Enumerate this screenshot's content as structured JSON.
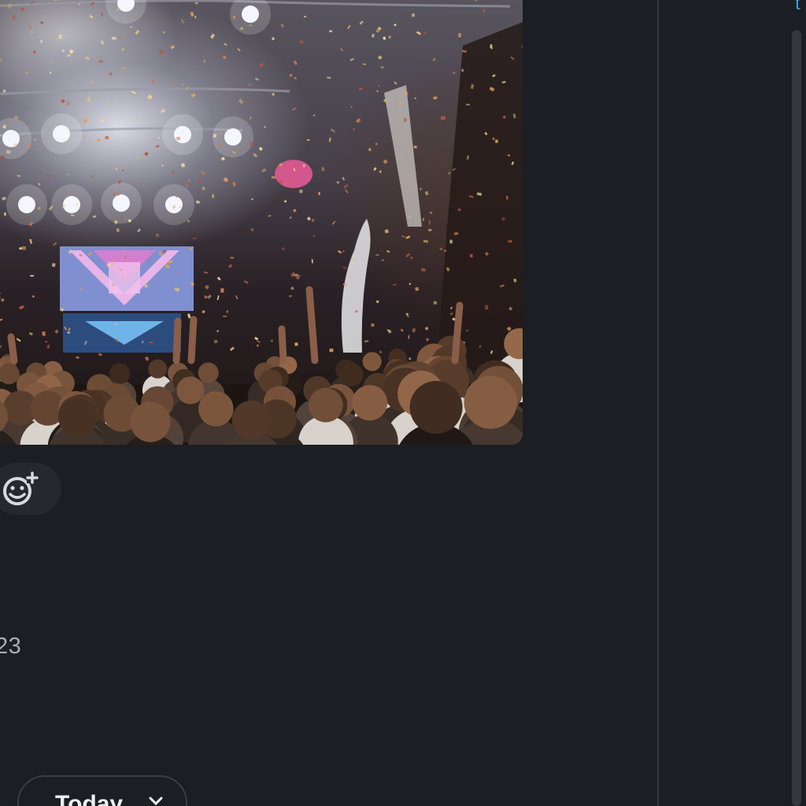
{
  "message": {
    "photo": {
      "alt": "concert-crowd-confetti-photo",
      "palette": {
        "stage_light": "#f4f6fb",
        "screen_pink": "#d98fd0",
        "screen_blue": "#7aa7e6",
        "confetti_gold": "#d9a35a",
        "crowd_dark": "#1c1512"
      }
    },
    "reaction_button": {
      "icon": "add-emoji-icon"
    },
    "timestamp_fragment": "23"
  },
  "date_divider": {
    "label": "Today",
    "icon": "chevron-down-icon"
  },
  "side_panel": {
    "link_fragment": "t",
    "accent_color": "#3a9fe8"
  },
  "theme": {
    "background": "#1b1e22",
    "divider": "#34383d",
    "chip_border": "#3a3e44"
  }
}
